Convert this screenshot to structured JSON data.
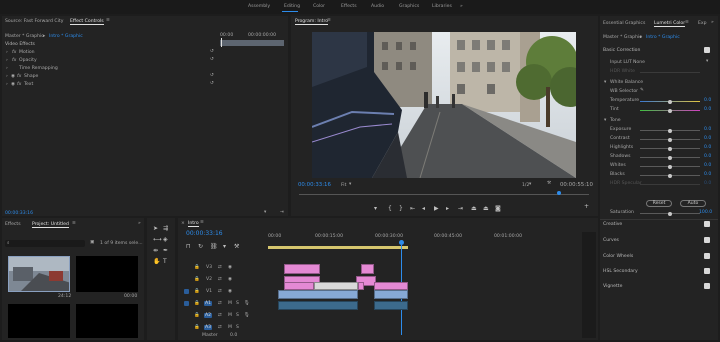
{
  "workspaces": [
    "Assembly",
    "Editing",
    "Color",
    "Effects",
    "Audio",
    "Graphics",
    "Libraries"
  ],
  "active_workspace": "Editing",
  "source_panel": {
    "tabs": [
      "Source: Fast Forward City",
      "Effect Controls"
    ],
    "breadcrumb_master": "Master * Graphic",
    "breadcrumb_seq": "Intro * Graphic",
    "ruler": [
      "00:00",
      "00:00:00:00"
    ],
    "section": "Video Effects",
    "effects": [
      "Motion",
      "Opacity",
      "Time Remapping",
      "Shape",
      "Text"
    ],
    "timecode": "00:00:33:16"
  },
  "program": {
    "title": "Program: Intro",
    "timecode_left": "00:00:33:16",
    "fit": "Fit",
    "resolution": "1/2",
    "timecode_right": "00:00:55:10"
  },
  "project": {
    "tabs": [
      "Effects",
      "Project: Untitled"
    ],
    "item_count": "1 of 9 items sele...",
    "thumbs": [
      {
        "duration": "24:12"
      },
      {
        "duration": "00:00"
      },
      {
        "duration": ""
      },
      {
        "duration": ""
      }
    ]
  },
  "timeline": {
    "tab": "Intro",
    "timecode": "00:00:33:16",
    "ruler": [
      "00:00",
      "00:00:15:00",
      "00:00:30:00",
      "00:00:45:00",
      "00:01:00:00"
    ],
    "video_tracks": [
      "V3",
      "V2",
      "V1"
    ],
    "audio_tracks": [
      "A1",
      "A2",
      "A3"
    ],
    "master": "Master",
    "master_value": "0.0"
  },
  "lumetri": {
    "tabs": [
      "Essential Graphics",
      "Lumetri Color",
      "Exp"
    ],
    "breadcrumb_master": "Master * Graphic",
    "breadcrumb_seq": "Intro * Graphic",
    "basic": "Basic Correction",
    "input_lut_label": "Input LUT",
    "input_lut_value": "None",
    "hdr_label": "HDR White",
    "white_balance": "White Balance",
    "wb_selector": "WB Selector",
    "tone": "Tone",
    "sliders": [
      {
        "label": "Temperature",
        "value": "0.0",
        "pos": 0.5
      },
      {
        "label": "Tint",
        "value": "0.0",
        "pos": 0.5
      },
      {
        "label": "Exposure",
        "value": "0.0",
        "pos": 0.5
      },
      {
        "label": "Contrast",
        "value": "0.0",
        "pos": 0.5
      },
      {
        "label": "Highlights",
        "value": "0.0",
        "pos": 0.5
      },
      {
        "label": "Shadows",
        "value": "0.0",
        "pos": 0.5
      },
      {
        "label": "Whites",
        "value": "0.0",
        "pos": 0.5
      },
      {
        "label": "Blacks",
        "value": "0.0",
        "pos": 0.5
      },
      {
        "label": "HDR Specular",
        "value": "0.0",
        "pos": 0.5
      }
    ],
    "reset": "Reset",
    "auto": "Auto",
    "saturation_label": "Saturation",
    "saturation_value": "100.0",
    "sections": [
      "Creative",
      "Curves",
      "Color Wheels",
      "HSL Secondary",
      "Vignette"
    ]
  }
}
